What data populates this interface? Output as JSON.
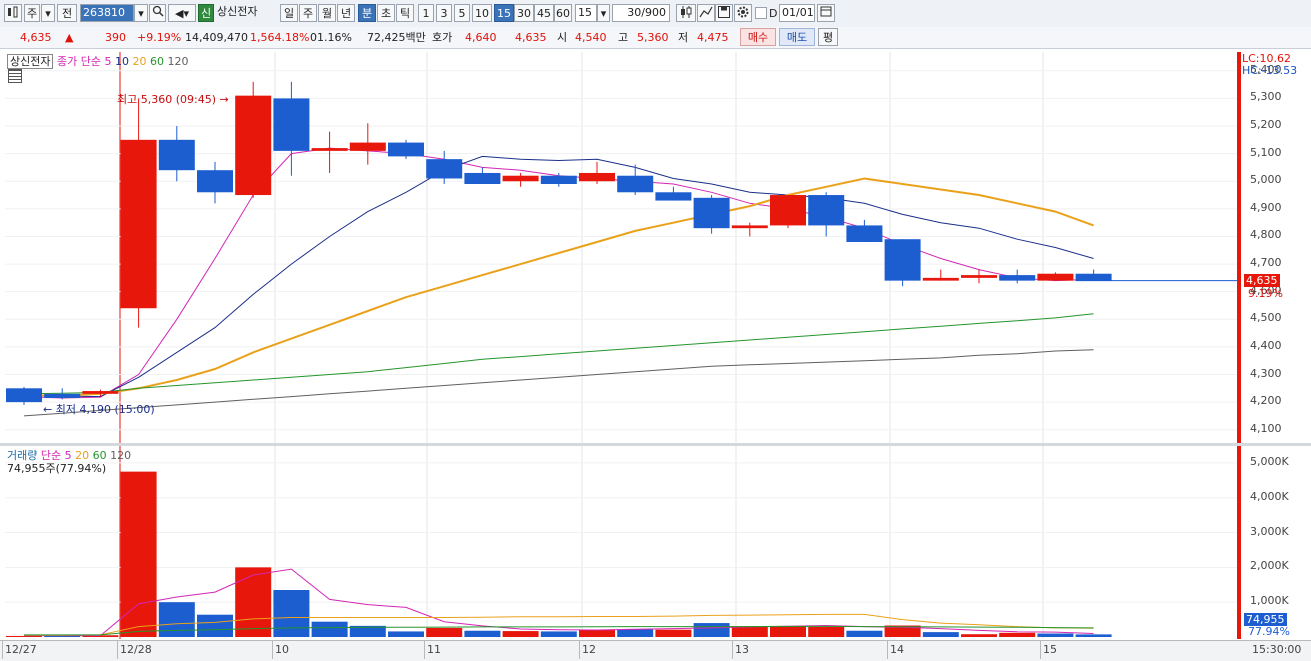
{
  "toolbar": {
    "period_tabs": [
      "주",
      "전"
    ],
    "stock_code": "263810",
    "market_badge": "신",
    "stock_name": "상신전자",
    "interval_tabs": [
      "일",
      "주",
      "월",
      "년",
      "분",
      "초",
      "틱"
    ],
    "active_interval": "분",
    "minute_tabs": [
      "1",
      "3",
      "5",
      "10",
      "15",
      "30",
      "45",
      "60"
    ],
    "active_minute": "15",
    "minute_select_value": "15",
    "count_value": "30/900",
    "checkbox_label": "D",
    "date_value": "01/01"
  },
  "info": {
    "price": "4,635",
    "arrow": "▲",
    "change": "390",
    "change_pct": "+9.19%",
    "volume": "14,409,470",
    "volume_pct": "1,564.18%",
    "turnover_pct": "01.16%",
    "amount": "72,425백만",
    "quote_label": "호가",
    "ask": "4,640",
    "bid": "4,635",
    "open_label": "시",
    "open": "4,540",
    "high_label": "고",
    "high": "5,360",
    "low_label": "저",
    "low": "4,475",
    "buy_button": "매수",
    "sell_button": "매도",
    "eval_button": "평"
  },
  "price_pane": {
    "name_label": "상신전자",
    "ma_label": "종가 단순",
    "ma_periods": [
      "5",
      "10",
      "20",
      "60",
      "120"
    ],
    "lc": "LC:10.62",
    "hc": "HC:-13.53",
    "high_marker": "최고 5,360 (09:45)",
    "low_marker": "최저 4,190 (15:00)",
    "current_price_tag": "4,635",
    "current_pct_tag": "9.19%"
  },
  "volume_pane": {
    "title": "거래량",
    "ma_label": "단순",
    "ma_periods": [
      "5",
      "20",
      "60",
      "120"
    ],
    "current_label": "74,955주(77.94%)",
    "current_tag": "74,955",
    "current_pct_tag": "77.94%"
  },
  "colors": {
    "up": "#e8170c",
    "down": "#1c5dd0",
    "ma5": "#d326b4",
    "ma10": "#1a2f8a",
    "ma20": "#eaa11a",
    "ma60": "#25952c",
    "ma120": "#606060"
  },
  "x_axis": {
    "labels": [
      "12/27",
      "12/28",
      "10",
      "11",
      "12",
      "13",
      "14",
      "15"
    ],
    "time_tag": "15:30:00"
  },
  "chart_data": [
    {
      "type": "candlestick",
      "interval": "15분",
      "x": [
        "12/27 15:00",
        "12/27 15:15",
        "12/27 15:30",
        "12/28 09:15",
        "12/28 09:30",
        "12/28 09:45",
        "12/28 10:00",
        "12/28 10:15",
        "12/28 10:30",
        "12/28 10:45",
        "12/28 11:00",
        "12/28 11:15",
        "12/28 11:30",
        "12/28 11:45",
        "12/28 12:00",
        "12/28 12:15",
        "12/28 12:30",
        "12/28 12:45",
        "12/28 13:00",
        "12/28 13:15",
        "12/28 13:30",
        "12/28 13:45",
        "12/28 14:00",
        "12/28 14:15",
        "12/28 14:30",
        "12/28 14:45",
        "12/28 15:00",
        "12/28 15:15",
        "12/28 15:30"
      ],
      "ohlc": [
        [
          4250,
          4255,
          4190,
          4200
        ],
        [
          4230,
          4250,
          4210,
          4215
        ],
        [
          4230,
          4245,
          4220,
          4240
        ],
        [
          4540,
          5300,
          4470,
          5150
        ],
        [
          5150,
          5200,
          5000,
          5040
        ],
        [
          5040,
          5070,
          4920,
          4960
        ],
        [
          4950,
          5360,
          4940,
          5310
        ],
        [
          5300,
          5360,
          5020,
          5110
        ],
        [
          5110,
          5180,
          5030,
          5120
        ],
        [
          5110,
          5210,
          5060,
          5140
        ],
        [
          5140,
          5150,
          5080,
          5090
        ],
        [
          5080,
          5110,
          4990,
          5010
        ],
        [
          5030,
          5050,
          4990,
          4990
        ],
        [
          5000,
          5030,
          4980,
          5020
        ],
        [
          5020,
          5030,
          4980,
          4990
        ],
        [
          5000,
          5070,
          4990,
          5030
        ],
        [
          5020,
          5060,
          4950,
          4960
        ],
        [
          4960,
          4980,
          4930,
          4930
        ],
        [
          4940,
          4950,
          4810,
          4830
        ],
        [
          4830,
          4850,
          4800,
          4840
        ],
        [
          4840,
          4950,
          4830,
          4950
        ],
        [
          4950,
          4960,
          4800,
          4840
        ],
        [
          4840,
          4860,
          4780,
          4780
        ],
        [
          4790,
          4790,
          4620,
          4640
        ],
        [
          4640,
          4680,
          4640,
          4650
        ],
        [
          4650,
          4680,
          4630,
          4660
        ],
        [
          4660,
          4680,
          4630,
          4640
        ],
        [
          4640,
          4670,
          4640,
          4665
        ],
        [
          4665,
          4680,
          4650,
          4640
        ]
      ],
      "y_ticks": [
        4100,
        4200,
        4300,
        4400,
        4500,
        4600,
        4700,
        4800,
        4900,
        5000,
        5100,
        5200,
        5300,
        5400
      ],
      "ylim": [
        4070,
        5450
      ],
      "series": [
        {
          "name": "5",
          "values": [
            4220,
            4215,
            4218,
            4300,
            4500,
            4720,
            4950,
            5100,
            5120,
            5110,
            5100,
            5080,
            5050,
            5040,
            5020,
            5010,
            5000,
            4990,
            4960,
            4920,
            4900,
            4870,
            4830,
            4770,
            4720,
            4680,
            4650,
            4640,
            4645
          ]
        },
        {
          "name": "10",
          "values": [
            4225,
            4222,
            4220,
            4290,
            4380,
            4470,
            4590,
            4700,
            4800,
            4890,
            4960,
            5040,
            5090,
            5080,
            5075,
            5080,
            5050,
            5010,
            4990,
            4960,
            4950,
            4940,
            4920,
            4880,
            4850,
            4830,
            4790,
            4760,
            4720
          ]
        },
        {
          "name": "20",
          "values": [
            4225,
            4223,
            4230,
            4250,
            4280,
            4320,
            4380,
            4430,
            4480,
            4530,
            4580,
            4620,
            4660,
            4700,
            4740,
            4780,
            4820,
            4850,
            4880,
            4910,
            4950,
            4980,
            5010,
            4990,
            4970,
            4950,
            4920,
            4890,
            4840
          ]
        },
        {
          "name": "60",
          "values": [
            4230,
            4232,
            4235,
            4250,
            4260,
            4270,
            4280,
            4290,
            4300,
            4310,
            4325,
            4340,
            4355,
            4365,
            4375,
            4385,
            4395,
            4405,
            4415,
            4425,
            4435,
            4445,
            4455,
            4465,
            4475,
            4485,
            4495,
            4505,
            4520
          ]
        },
        {
          "name": "120",
          "values": [
            4150,
            4160,
            4170,
            4180,
            4190,
            4200,
            4210,
            4220,
            4230,
            4240,
            4250,
            4260,
            4270,
            4280,
            4290,
            4300,
            4310,
            4320,
            4330,
            4335,
            4340,
            4345,
            4350,
            4355,
            4360,
            4370,
            4375,
            4385,
            4390
          ]
        }
      ]
    },
    {
      "type": "bar",
      "title": "거래량",
      "x": [
        "12/27 15:00",
        "12/27 15:15",
        "12/27 15:30",
        "12/28 09:15",
        "12/28 09:30",
        "12/28 09:45",
        "12/28 10:00",
        "12/28 10:15",
        "12/28 10:30",
        "12/28 10:45",
        "12/28 11:00",
        "12/28 11:15",
        "12/28 11:30",
        "12/28 11:45",
        "12/28 12:00",
        "12/28 12:15",
        "12/28 12:30",
        "12/28 12:45",
        "12/28 13:00",
        "12/28 13:15",
        "12/28 13:30",
        "12/28 13:45",
        "12/28 14:00",
        "12/28 14:15",
        "12/28 14:30",
        "12/28 14:45",
        "12/28 15:00",
        "12/28 15:15",
        "12/28 15:30"
      ],
      "values": [
        30,
        40,
        50,
        4750,
        1000,
        640,
        2000,
        1350,
        440,
        320,
        160,
        260,
        180,
        170,
        160,
        200,
        220,
        210,
        400,
        310,
        300,
        290,
        180,
        330,
        140,
        80,
        120,
        100,
        75
      ],
      "up": [
        true,
        false,
        true,
        true,
        false,
        false,
        true,
        false,
        false,
        false,
        false,
        true,
        false,
        true,
        false,
        true,
        false,
        true,
        false,
        true,
        true,
        true,
        false,
        true,
        false,
        true,
        true,
        false,
        false
      ],
      "y_ticks": [
        "1,000K",
        "2,000K",
        "3,000K",
        "4,000K",
        "5,000K"
      ],
      "ylim": [
        0,
        5400
      ],
      "series": [
        {
          "name": "5",
          "values": [
            40,
            40,
            40,
            950,
            1150,
            1290,
            1780,
            1950,
            1080,
            930,
            850,
            440,
            320,
            230,
            210,
            200,
            220,
            240,
            260,
            290,
            310,
            330,
            300,
            280,
            240,
            190,
            150,
            140,
            100
          ]
        },
        {
          "name": "20",
          "values": [
            50,
            50,
            60,
            300,
            380,
            420,
            520,
            560,
            560,
            560,
            560,
            560,
            570,
            580,
            580,
            590,
            590,
            600,
            620,
            630,
            640,
            650,
            650,
            500,
            400,
            350,
            300,
            260,
            250
          ]
        },
        {
          "name": "60",
          "values": [
            60,
            60,
            60,
            160,
            190,
            210,
            240,
            260,
            270,
            280,
            280,
            285,
            290,
            290,
            290,
            295,
            300,
            300,
            300,
            300,
            305,
            305,
            300,
            295,
            290,
            285,
            280,
            270,
            260
          ]
        }
      ]
    }
  ]
}
